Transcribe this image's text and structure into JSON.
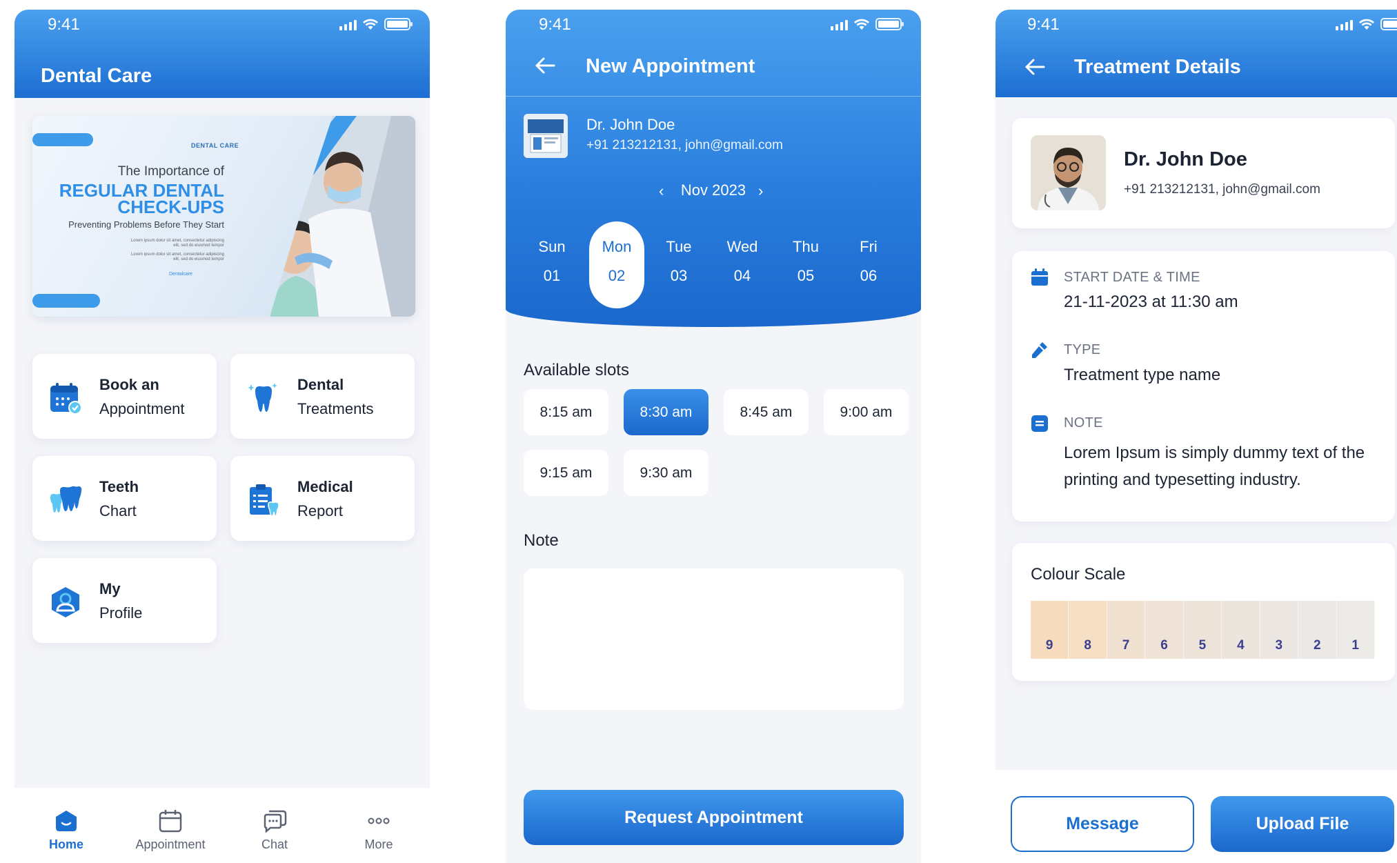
{
  "status": {
    "time": "9:41"
  },
  "home": {
    "title": "Dental Care",
    "banner": {
      "brand": "DENTAL CARE",
      "line1": "The Importance of",
      "line2a": "REGULAR DENTAL",
      "line2b": "CHECK-UPS",
      "line3": "Preventing Problems Before They Start",
      "small1": "Lorem ipsum dolor sit amet, consectetur adipiscing elit, sed do eiusmod tempor",
      "small2": "Lorem ipsum dolor sit amet, consectetur adipiscing elit, sed do eiusmod tempor",
      "tag": "Dentalcare"
    },
    "tiles": [
      {
        "l1": "Book an",
        "l2": "Appointment",
        "icon": "calendar-check-icon"
      },
      {
        "l1": "Dental",
        "l2": "Treatments",
        "icon": "tooth-sparkle-icon"
      },
      {
        "l1": "Teeth",
        "l2": "Chart",
        "icon": "teeth-icon"
      },
      {
        "l1": "Medical",
        "l2": "Report",
        "icon": "clipboard-icon"
      },
      {
        "l1": "My",
        "l2": "Profile",
        "icon": "profile-icon"
      }
    ],
    "nav": [
      {
        "label": "Home",
        "icon": "home-icon",
        "active": true
      },
      {
        "label": "Appointment",
        "icon": "calendar-icon",
        "active": false
      },
      {
        "label": "Chat",
        "icon": "chat-icon",
        "active": false
      },
      {
        "label": "More",
        "icon": "more-icon",
        "active": false
      }
    ]
  },
  "appointment": {
    "title": "New Appointment",
    "doctor": {
      "name": "Dr. John Doe",
      "contact": "+91 213212131, john@gmail.com"
    },
    "month": "Nov 2023",
    "days": [
      {
        "name": "Sun",
        "date": "01",
        "selected": false
      },
      {
        "name": "Mon",
        "date": "02",
        "selected": true
      },
      {
        "name": "Tue",
        "date": "03",
        "selected": false
      },
      {
        "name": "Wed",
        "date": "04",
        "selected": false
      },
      {
        "name": "Thu",
        "date": "05",
        "selected": false
      },
      {
        "name": "Fri",
        "date": "06",
        "selected": false
      }
    ],
    "slots_title": "Available slots",
    "slots": [
      {
        "label": "8:15 am",
        "selected": false
      },
      {
        "label": "8:30 am",
        "selected": true
      },
      {
        "label": "8:45 am",
        "selected": false
      },
      {
        "label": "9:00 am",
        "selected": false
      },
      {
        "label": "9:15 am",
        "selected": false
      },
      {
        "label": "9:30 am",
        "selected": false
      }
    ],
    "note_title": "Note",
    "note_value": "",
    "submit": "Request Appointment"
  },
  "treatment": {
    "title": "Treatment Details",
    "doctor": {
      "name": "Dr. John Doe",
      "contact": "+91 213212131, john@gmail.com"
    },
    "start_label": "START DATE & TIME",
    "start_value": "21-11-2023 at 11:30 am",
    "type_label": "TYPE",
    "type_value": "Treatment type name",
    "note_label": "NOTE",
    "note_value": "Lorem Ipsum is simply dummy text of the printing and typesetting industry.",
    "colour_title": "Colour Scale",
    "scale": [
      {
        "n": "9",
        "color": "#f6dcbc"
      },
      {
        "n": "8",
        "color": "#f5e0c6"
      },
      {
        "n": "7",
        "color": "#f1e1d0"
      },
      {
        "n": "6",
        "color": "#efe2d6"
      },
      {
        "n": "5",
        "color": "#ede3d9"
      },
      {
        "n": "4",
        "color": "#ece5de"
      },
      {
        "n": "3",
        "color": "#ebe6e2"
      },
      {
        "n": "2",
        "color": "#ebe8e5"
      },
      {
        "n": "1",
        "color": "#eceae7"
      }
    ],
    "message": "Message",
    "upload": "Upload File"
  },
  "colors": {
    "primary": "#1b6fd0",
    "header_top": "#4aa0ee",
    "background": "#f4f5f9"
  }
}
